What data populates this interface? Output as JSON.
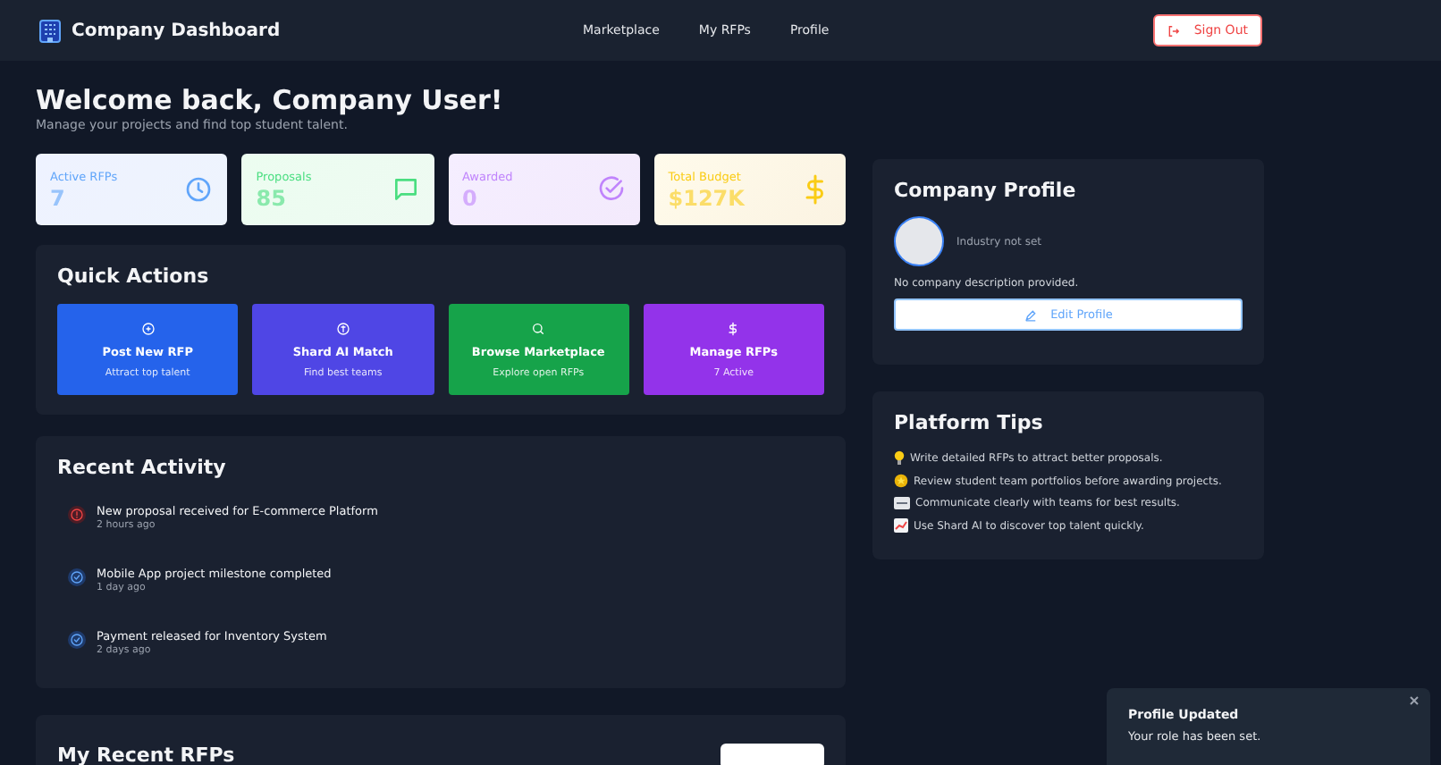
{
  "header": {
    "title": "Company Dashboard",
    "nav": [
      {
        "label": "Marketplace"
      },
      {
        "label": "My RFPs"
      },
      {
        "label": "Profile"
      }
    ],
    "sign_out": "Sign Out"
  },
  "welcome": {
    "title": "Welcome back, Company User!",
    "subtitle": "Manage your projects and find top student talent."
  },
  "stats": [
    {
      "kind": "clock",
      "label": "Active RFPs",
      "value": "7",
      "color": "#60a5fa"
    },
    {
      "kind": "message",
      "label": "Proposals",
      "value": "85",
      "color": "#4ade80"
    },
    {
      "kind": "check",
      "label": "Awarded",
      "value": "0",
      "color": "#c084fc"
    },
    {
      "kind": "dollar",
      "label": "Total Budget",
      "value": "$127K",
      "color": "#facc15"
    }
  ],
  "quick_actions": {
    "title": "Quick Actions",
    "items": [
      {
        "kind": "plus",
        "title": "Post New RFP",
        "subtitle": "Attract top talent",
        "color": "#2563eb"
      },
      {
        "kind": "ai",
        "title": "Shard AI Match",
        "subtitle": "Find best teams",
        "color": "#4f46e5"
      },
      {
        "kind": "search",
        "title": "Browse Marketplace",
        "subtitle": "Explore open RFPs",
        "color": "#16a34a"
      },
      {
        "kind": "dollar",
        "title": "Manage RFPs",
        "subtitle": "7 Active",
        "color": "#9333ea"
      }
    ]
  },
  "recent_activity": {
    "title": "Recent Activity",
    "items": [
      {
        "kind": "alert",
        "text": "New proposal received for E-commerce Platform",
        "time": "2 hours ago"
      },
      {
        "kind": "check",
        "text": "Mobile App project milestone completed",
        "time": "1 day ago"
      },
      {
        "kind": "check",
        "text": "Payment released for Inventory System",
        "time": "2 days ago"
      }
    ]
  },
  "recent_rfps": {
    "title": "My Recent RFPs"
  },
  "company_profile": {
    "title": "Company Profile",
    "industry": "Industry not set",
    "description": "No company description provided.",
    "edit_button": "Edit Profile"
  },
  "platform_tips": {
    "title": "Platform Tips",
    "items": [
      {
        "kind": "bulb",
        "text": "Write detailed RFPs to attract better proposals."
      },
      {
        "kind": "star",
        "text": "Review student team portfolios before awarding projects."
      },
      {
        "kind": "message",
        "text": "Communicate clearly with teams for best results."
      },
      {
        "kind": "chart",
        "text": "Use Shard AI to discover top talent quickly."
      }
    ]
  },
  "toast": {
    "title": "Profile Updated",
    "message": "Your role has been set."
  }
}
